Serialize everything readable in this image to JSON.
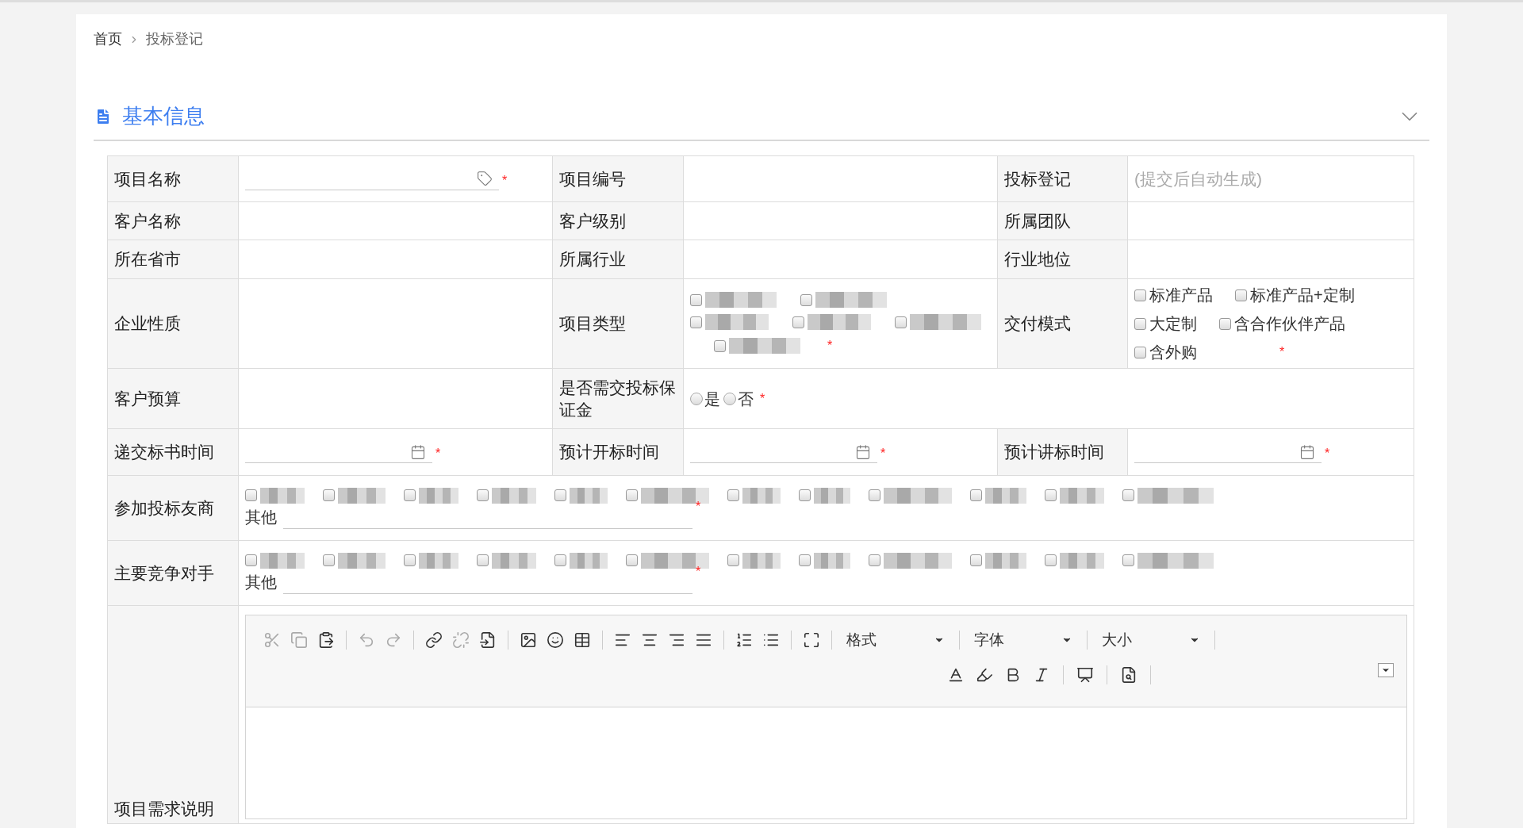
{
  "breadcrumb": [
    {
      "label": "首页"
    },
    {
      "label": "投标登记"
    }
  ],
  "section": {
    "title": "基本信息",
    "expanded": true
  },
  "rows": [
    {
      "cells": [
        {
          "label": "项目名称",
          "field": {
            "kind": "tag_input",
            "required_mark": "*"
          }
        },
        {
          "label": "项目编号",
          "field": {
            "kind": "empty"
          }
        },
        {
          "label": "投标登记",
          "field": {
            "kind": "note",
            "text": "(提交后自动生成)"
          }
        }
      ]
    },
    {
      "cells": [
        {
          "label": "客户名称",
          "field": {
            "kind": "empty"
          }
        },
        {
          "label": "客户级别",
          "field": {
            "kind": "empty"
          }
        },
        {
          "label": "所属团队",
          "field": {
            "kind": "empty"
          }
        }
      ]
    },
    {
      "cells": [
        {
          "label": "所在省市",
          "field": {
            "kind": "empty"
          }
        },
        {
          "label": "所属行业",
          "field": {
            "kind": "empty"
          }
        },
        {
          "label": "行业地位",
          "field": {
            "kind": "empty"
          }
        }
      ]
    },
    {
      "cells": [
        {
          "label": "企业性质",
          "field": {
            "kind": "empty"
          }
        },
        {
          "label": "项目类型",
          "field": {
            "kind": "blurred_checks",
            "required_mark": "*",
            "options": [
              {
                "checked": false
              },
              {
                "checked": false
              },
              {
                "checked": false
              },
              {
                "checked": false
              },
              {
                "checked": false
              },
              {
                "checked": false
              }
            ]
          }
        },
        {
          "label": "交付模式",
          "field": {
            "kind": "checks",
            "required_mark": "*",
            "options": [
              {
                "label": "标准产品",
                "checked": false
              },
              {
                "label": "标准产品+定制",
                "checked": false
              },
              {
                "label": "大定制",
                "checked": false
              },
              {
                "label": "含合作伙伴产品",
                "checked": false
              },
              {
                "label": "含外购",
                "checked": false
              }
            ]
          }
        }
      ]
    },
    {
      "cells": [
        {
          "label": "客户预算",
          "field": {
            "kind": "empty"
          }
        },
        {
          "label": "是否需交投标保证金",
          "field": {
            "kind": "radios",
            "required_mark": "*",
            "options": [
              {
                "label": "是",
                "selected": false
              },
              {
                "label": "否",
                "selected": false
              }
            ]
          }
        }
      ]
    },
    {
      "cells": [
        {
          "label": "递交标书时间",
          "field": {
            "kind": "date_input",
            "required_mark": "*"
          }
        },
        {
          "label": "预计开标时间",
          "field": {
            "kind": "date_input",
            "required_mark": "*"
          }
        },
        {
          "label": "预计讲标时间",
          "field": {
            "kind": "date_input",
            "required_mark": "*"
          }
        }
      ]
    },
    {
      "cells": [
        {
          "label": "参加投标友商",
          "field": {
            "kind": "blurred_other",
            "other_label": "其他",
            "required_mark": "*",
            "options": [
              {
                "checked": false
              },
              {
                "checked": false
              },
              {
                "checked": false
              },
              {
                "checked": false
              },
              {
                "checked": false
              },
              {
                "checked": false
              },
              {
                "checked": false
              },
              {
                "checked": false
              },
              {
                "checked": false
              },
              {
                "checked": false
              },
              {
                "checked": false
              },
              {
                "checked": false
              }
            ]
          }
        }
      ]
    },
    {
      "cells": [
        {
          "label": "主要竞争对手",
          "field": {
            "kind": "blurred_other",
            "other_label": "其他",
            "required_mark": "*",
            "options": [
              {
                "checked": false
              },
              {
                "checked": false
              },
              {
                "checked": false
              },
              {
                "checked": false
              },
              {
                "checked": false
              },
              {
                "checked": false
              },
              {
                "checked": false
              },
              {
                "checked": false
              },
              {
                "checked": false
              },
              {
                "checked": false
              },
              {
                "checked": false
              },
              {
                "checked": false
              }
            ]
          }
        }
      ]
    },
    {
      "cells": [
        {
          "label": "项目需求说明",
          "field": {
            "kind": "editor",
            "dropdowns": [
              {
                "label": "格式"
              },
              {
                "label": "字体"
              },
              {
                "label": "大小"
              }
            ]
          }
        }
      ]
    }
  ]
}
